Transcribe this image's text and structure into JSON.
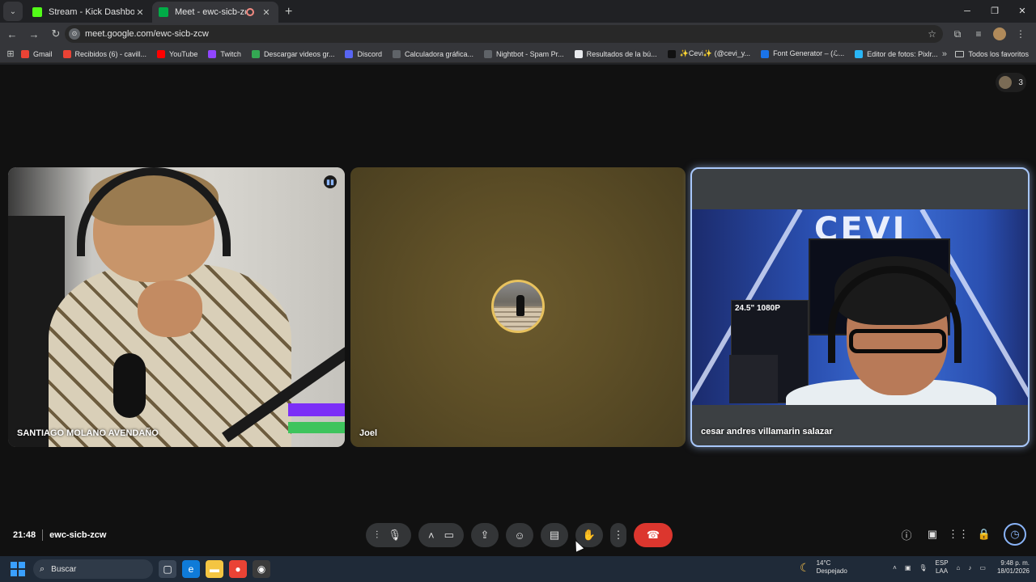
{
  "browser": {
    "tabs": [
      {
        "label": "Stream - Kick Dashboard",
        "color": "#53fc18"
      },
      {
        "label": "Meet - ewc-sicb-zcw",
        "color": "#00ac47"
      }
    ],
    "url": "meet.google.com/ewc-sicb-zcw",
    "bookmarks": [
      {
        "label": "Gmail",
        "color": "#ea4335"
      },
      {
        "label": "Recibidos (6) - cavill...",
        "color": "#ea4335"
      },
      {
        "label": "YouTube",
        "color": "#ff0000"
      },
      {
        "label": "Twitch",
        "color": "#9146ff"
      },
      {
        "label": "Descargar videos gr...",
        "color": "#34a853"
      },
      {
        "label": "Discord",
        "color": "#5865f2"
      },
      {
        "label": "Calculadora gráfica...",
        "color": "#5f6368"
      },
      {
        "label": "Nightbot - Spam Pr...",
        "color": "#5f6368"
      },
      {
        "label": "Resultados de la bú...",
        "color": "#e8eaed"
      },
      {
        "label": "✨Cevi✨ (@cevi_y...",
        "color": "#111111"
      },
      {
        "label": "Font Generator – (ℒ...",
        "color": "#1a73e8"
      },
      {
        "label": "Editor de fotos: Pixlr...",
        "color": "#29b6f6"
      }
    ],
    "all_bookmarks": "Todos los favoritos"
  },
  "meet": {
    "participants_count": "3",
    "tiles": [
      {
        "name": "SANTIAGO MOLANO AVENDAÑO"
      },
      {
        "name": "Joel"
      },
      {
        "name": "cesar andres villamarin salazar"
      }
    ],
    "cesar_bg_logo": "CEVI",
    "cesar_box_text": "24.5\" 1080P",
    "time": "21:48",
    "meeting_code": "ewc-sicb-zcw"
  },
  "taskbar": {
    "search_placeholder": "Buscar",
    "temperature": "14°C",
    "weather": "Despejado",
    "lang_top": "ESP",
    "lang_bottom": "LAA",
    "clock_time": "9:48 p. m.",
    "clock_date": "18/01/2026"
  }
}
